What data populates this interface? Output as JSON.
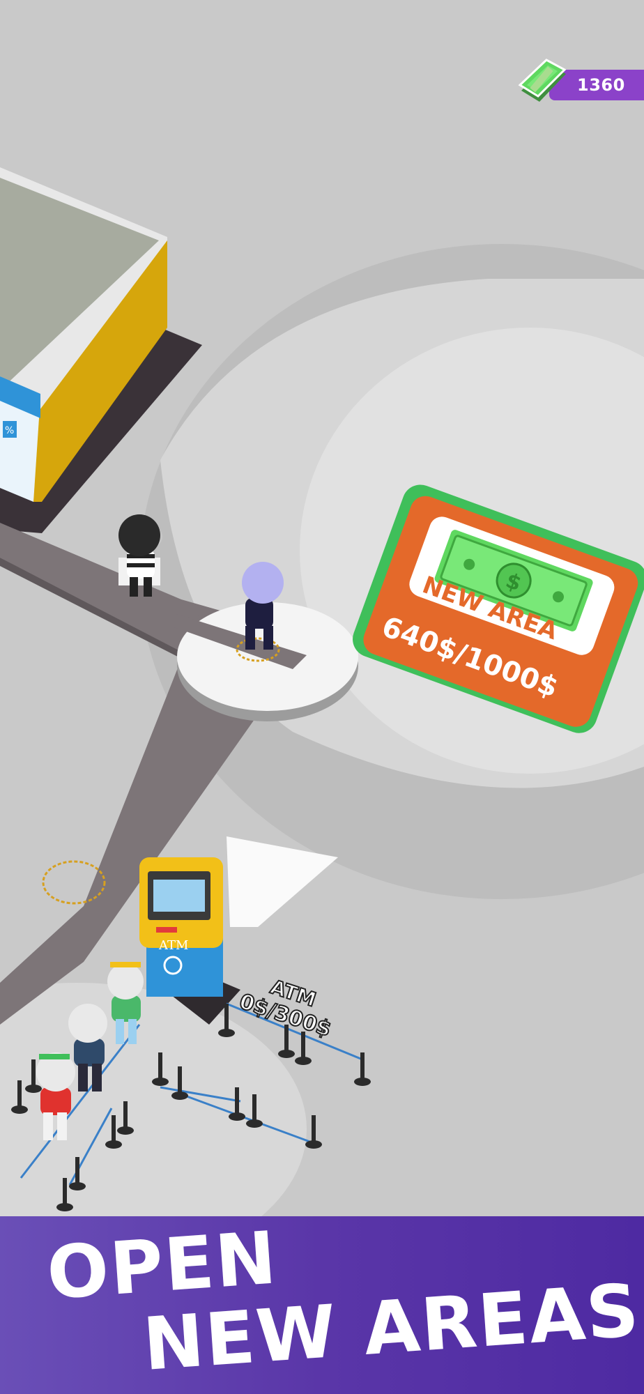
{
  "hud": {
    "money_value": "1360",
    "icons": [
      "cash-stack-icon"
    ]
  },
  "new_area": {
    "title": "NEW AREA",
    "progress_text": "640$/1000$",
    "progress_fraction": 0.64,
    "icon": "dollar-bill-icon"
  },
  "atm": {
    "title": "ATM",
    "progress_text": "0$/300$",
    "sign_text": "ATM"
  },
  "banner": {
    "line1": "OPEN",
    "line2": "NEW AREAS"
  },
  "colors": {
    "ground": "#c9c9c9",
    "path": "#7d7578",
    "accent_purple": "#8b42c9",
    "new_area_orange": "#e4692a",
    "new_area_green": "#3fbf5a",
    "banner_purple": "#5a36a8",
    "store_yellow": "#d6a60c",
    "atm_blue": "#2f93d8"
  }
}
